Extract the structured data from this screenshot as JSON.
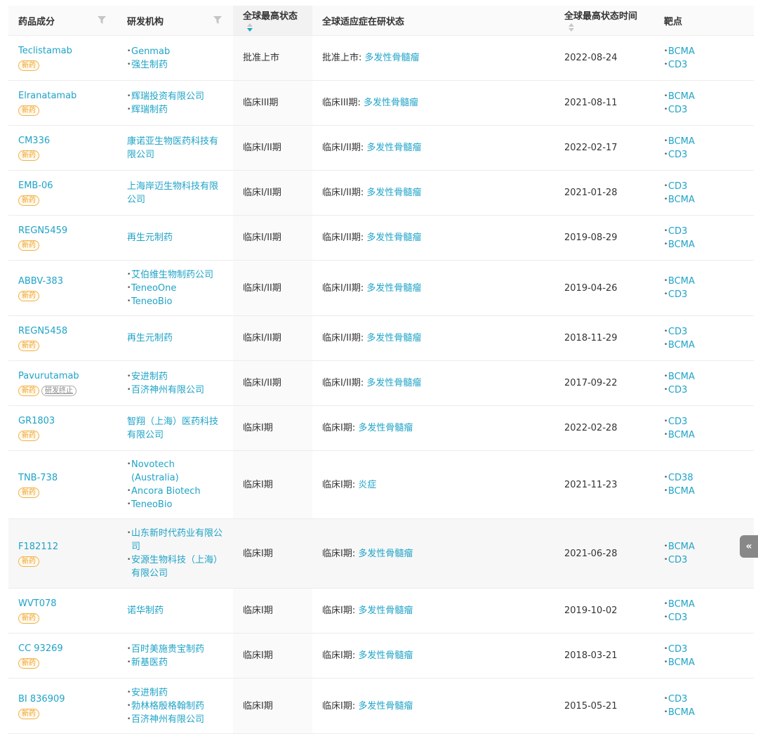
{
  "columns": {
    "drug": "药品成分",
    "org": "研发机构",
    "status": "全球最高状态",
    "indication": "全球适应症在研状态",
    "date": "全球最高状态时间",
    "target": "靶点"
  },
  "badges": {
    "new": "新药",
    "stopped": "研发终止"
  },
  "side_tab_label": "«",
  "rows": [
    {
      "drug": "Teclistamab",
      "badges": [
        "新药"
      ],
      "orgs": [
        "Genmab",
        "强生制药"
      ],
      "org_bullets": true,
      "status": "批准上市",
      "indication_prefix": "批准上市:",
      "indication": "多发性骨髓瘤",
      "date": "2022-08-24",
      "targets": [
        "BCMA",
        "CD3"
      ]
    },
    {
      "drug": "Elranatamab",
      "badges": [
        "新药"
      ],
      "orgs": [
        "辉瑞投资有限公司",
        "辉瑞制药"
      ],
      "org_bullets": true,
      "status": "临床III期",
      "indication_prefix": "临床III期:",
      "indication": "多发性骨髓瘤",
      "date": "2021-08-11",
      "targets": [
        "BCMA",
        "CD3"
      ]
    },
    {
      "drug": "CM336",
      "badges": [
        "新药"
      ],
      "orgs": [
        "康诺亚生物医药科技有限公司"
      ],
      "org_bullets": false,
      "status": "临床I/II期",
      "indication_prefix": "临床I/II期:",
      "indication": "多发性骨髓瘤",
      "date": "2022-02-17",
      "targets": [
        "BCMA",
        "CD3"
      ]
    },
    {
      "drug": "EMB-06",
      "badges": [
        "新药"
      ],
      "orgs": [
        "上海岸迈生物科技有限公司"
      ],
      "org_bullets": false,
      "status": "临床I/II期",
      "indication_prefix": "临床I/II期:",
      "indication": "多发性骨髓瘤",
      "date": "2021-01-28",
      "targets": [
        "CD3",
        "BCMA"
      ]
    },
    {
      "drug": "REGN5459",
      "badges": [
        "新药"
      ],
      "orgs": [
        "再生元制药"
      ],
      "org_bullets": false,
      "status": "临床I/II期",
      "indication_prefix": "临床I/II期:",
      "indication": "多发性骨髓瘤",
      "date": "2019-08-29",
      "targets": [
        "CD3",
        "BCMA"
      ]
    },
    {
      "drug": "ABBV-383",
      "badges": [
        "新药"
      ],
      "orgs": [
        "艾伯维生物制药公司",
        "TeneoOne",
        "TeneoBio"
      ],
      "org_bullets": true,
      "status": "临床I/II期",
      "indication_prefix": "临床I/II期:",
      "indication": "多发性骨髓瘤",
      "date": "2019-04-26",
      "targets": [
        "BCMA",
        "CD3"
      ]
    },
    {
      "drug": "REGN5458",
      "badges": [
        "新药"
      ],
      "orgs": [
        "再生元制药"
      ],
      "org_bullets": false,
      "status": "临床I/II期",
      "indication_prefix": "临床I/II期:",
      "indication": "多发性骨髓瘤",
      "date": "2018-11-29",
      "targets": [
        "CD3",
        "BCMA"
      ]
    },
    {
      "drug": "Pavurutamab",
      "badges": [
        "新药",
        "研发终止"
      ],
      "orgs": [
        "安进制药",
        "百济神州有限公司"
      ],
      "org_bullets": true,
      "status": "临床I/II期",
      "indication_prefix": "临床I/II期:",
      "indication": "多发性骨髓瘤",
      "date": "2017-09-22",
      "targets": [
        "BCMA",
        "CD3"
      ]
    },
    {
      "drug": "GR1803",
      "badges": [
        "新药"
      ],
      "orgs": [
        "智翔（上海）医药科技有限公司"
      ],
      "org_bullets": false,
      "status": "临床I期",
      "indication_prefix": "临床I期:",
      "indication": "多发性骨髓瘤",
      "date": "2022-02-28",
      "targets": [
        "CD3",
        "BCMA"
      ]
    },
    {
      "drug": "TNB-738",
      "badges": [
        "新药"
      ],
      "orgs": [
        "Novotech (Australia)",
        "Ancora Biotech",
        "TeneoBio"
      ],
      "org_bullets": true,
      "status": "临床I期",
      "indication_prefix": "临床I期:",
      "indication": "炎症",
      "date": "2021-11-23",
      "targets": [
        "CD38",
        "BCMA"
      ]
    },
    {
      "drug": "F182112",
      "badges": [
        "新药"
      ],
      "orgs": [
        "山东新时代药业有限公司",
        "安源生物科技（上海）有限公司"
      ],
      "org_bullets": true,
      "status": "临床I期",
      "indication_prefix": "临床I期:",
      "indication": "多发性骨髓瘤",
      "date": "2021-06-28",
      "targets": [
        "BCMA",
        "CD3"
      ]
    },
    {
      "drug": "WVT078",
      "badges": [
        "新药"
      ],
      "orgs": [
        "诺华制药"
      ],
      "org_bullets": false,
      "status": "临床I期",
      "indication_prefix": "临床I期:",
      "indication": "多发性骨髓瘤",
      "date": "2019-10-02",
      "targets": [
        "BCMA",
        "CD3"
      ]
    },
    {
      "drug": "CC 93269",
      "badges": [
        "新药"
      ],
      "orgs": [
        "百时美施贵宝制药",
        "新基医药"
      ],
      "org_bullets": true,
      "status": "临床I期",
      "indication_prefix": "临床I期:",
      "indication": "多发性骨髓瘤",
      "date": "2018-03-21",
      "targets": [
        "CD3",
        "BCMA"
      ]
    },
    {
      "drug": "BI 836909",
      "badges": [
        "新药"
      ],
      "orgs": [
        "安进制药",
        "勃林格殷格翰制药",
        "百济神州有限公司"
      ],
      "org_bullets": true,
      "status": "临床I期",
      "indication_prefix": "临床I期:",
      "indication": "多发性骨髓瘤",
      "date": "2015-05-21",
      "targets": [
        "CD3",
        "BCMA"
      ]
    }
  ]
}
